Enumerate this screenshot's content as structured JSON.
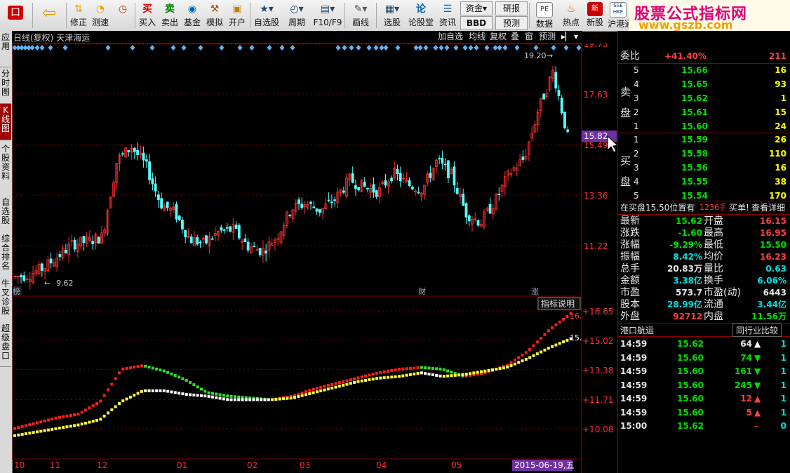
{
  "toolbar": {
    "items": [
      {
        "label": "",
        "icon": "app-logo-icon"
      },
      {
        "label": "",
        "icon": "back-arrow-icon"
      },
      {
        "label": "修正",
        "icon": "up-down-arrows-icon"
      },
      {
        "label": "测速",
        "icon": "speedometer-icon"
      },
      {
        "label": "买入",
        "icon": "buy-icon",
        "glyph": "买"
      },
      {
        "label": "卖出",
        "icon": "sell-icon",
        "glyph": "卖"
      },
      {
        "label": "基金",
        "icon": "fund-icon"
      },
      {
        "label": "模拟",
        "icon": "hammer-icon"
      },
      {
        "label": "开户",
        "icon": "lock-icon"
      },
      {
        "label": "自选股",
        "icon": "star-folder-icon"
      },
      {
        "label": "周期",
        "icon": "clock-icon"
      },
      {
        "label": "F10/F9",
        "icon": "f10-icon"
      },
      {
        "label": "画线",
        "icon": "pencil-icon"
      },
      {
        "label": "选股",
        "icon": "screen-icon"
      },
      {
        "label": "论股堂",
        "icon": "discuss-icon",
        "glyph": "论"
      },
      {
        "label": "资讯",
        "icon": "news-icon"
      },
      {
        "label": "数据",
        "icon": "pe-icon",
        "glyph": "PE"
      },
      {
        "label": "热点",
        "icon": "hot-icon"
      },
      {
        "label": "新股",
        "icon": "ipo-icon"
      },
      {
        "label": "沪港通",
        "icon": "sse-hkex-icon",
        "glyph": "SSE HKE"
      }
    ],
    "small_buttons": {
      "zijin": "资金",
      "bbd": "BBD",
      "yanbao": "研报",
      "yuce": "预测"
    },
    "brand_title": "股票公式指标网",
    "brand_url": "www.gszb.com"
  },
  "left_tabs": [
    "应用",
    "分时图",
    "K线图",
    "个股资料",
    "自选股",
    "综合排名",
    "牛叉诊股",
    "超级盘口"
  ],
  "chart": {
    "title": "日线(复权) 天津海运",
    "buttons": [
      "加自选",
      "均线",
      "复权",
      "叠",
      "窗",
      "预测"
    ],
    "price_axis": [
      "19.73",
      "17.63",
      "15.49",
      "13.36",
      "11.22"
    ],
    "current_price_tag": "15.82",
    "high_label": "19.20",
    "low_label": "9.62",
    "markers": [
      "榜",
      "财",
      "涨"
    ],
    "indicator_button": "指标说明",
    "indicator_axis": [
      "+16.65",
      "+15.02",
      "+13.38",
      "+11.71",
      "+10.08"
    ],
    "ind_end_red": "16.",
    "ind_end_yellow": "15.",
    "x_labels": [
      "10",
      "11",
      "12",
      "01",
      "02",
      "03",
      "04",
      "05"
    ],
    "date_tag": "2015-06-19,五"
  },
  "chart_data": {
    "type": "candlestick",
    "title": "日线(复权) 天津海运",
    "y_ticks": [
      19.73,
      17.63,
      15.49,
      13.36,
      11.22
    ],
    "high": 19.2,
    "low": 9.62,
    "last": 15.82,
    "months": [
      "10",
      "11",
      "12",
      "01",
      "02",
      "03",
      "04",
      "05"
    ],
    "trend": [
      9.9,
      10.0,
      10.3,
      10.8,
      11.3,
      11.4,
      11.6,
      14.8,
      15.4,
      14.6,
      13.0,
      12.6,
      11.5,
      11.3,
      11.8,
      11.9,
      11.2,
      11.0,
      11.6,
      12.8,
      13.0,
      12.7,
      13.2,
      14.0,
      13.7,
      13.5,
      14.3,
      13.8,
      13.6,
      14.8,
      14.2,
      12.6,
      12.2,
      13.1,
      14.3,
      14.9,
      17.0,
      18.6,
      15.8
    ],
    "indicator": {
      "red": [
        10.1,
        10.4,
        10.7,
        10.9,
        11.6,
        13.4,
        13.6,
        13.3,
        12.8,
        12.1,
        11.9,
        11.8,
        11.7,
        11.9,
        12.3,
        12.6,
        12.9,
        13.2,
        13.4,
        13.5,
        13.4,
        13.0,
        13.2,
        13.6,
        14.4,
        15.6,
        16.5
      ],
      "yellow": [
        9.7,
        9.9,
        10.1,
        10.3,
        10.6,
        11.6,
        12.2,
        12.2,
        12.0,
        11.9,
        11.7,
        11.7,
        11.7,
        11.8,
        12.1,
        12.4,
        12.7,
        12.9,
        13.0,
        13.2,
        13.0,
        13.1,
        13.3,
        13.5,
        14.0,
        14.6,
        15.1
      ],
      "y_ticks": [
        16.65,
        15.02,
        13.38,
        11.71,
        10.08
      ]
    }
  },
  "order_book": {
    "weibi_label": "委比",
    "weibi_value": "+41.40%",
    "weibi_count": "211",
    "sell_label": "卖盘",
    "buy_label": "买盘",
    "sell": [
      {
        "lvl": "5",
        "price": "15.66",
        "vol": "16"
      },
      {
        "lvl": "4",
        "price": "15.65",
        "vol": "93"
      },
      {
        "lvl": "3",
        "price": "15.62",
        "vol": "1"
      },
      {
        "lvl": "2",
        "price": "15.61",
        "vol": "15"
      },
      {
        "lvl": "1",
        "price": "15.60",
        "vol": "24"
      }
    ],
    "buy": [
      {
        "lvl": "1",
        "price": "15.59",
        "vol": "26"
      },
      {
        "lvl": "2",
        "price": "15.58",
        "vol": "110"
      },
      {
        "lvl": "3",
        "price": "15.56",
        "vol": "16"
      },
      {
        "lvl": "4",
        "price": "15.55",
        "vol": "38"
      },
      {
        "lvl": "5",
        "price": "15.54",
        "vol": "170"
      }
    ],
    "notice_pre": "在买盘15.50位置有",
    "notice_vol": "1236手",
    "notice_post": "买单!",
    "notice_link": "查看详细"
  },
  "quote": [
    [
      "最新",
      "15.62",
      "开盘",
      "16.15"
    ],
    [
      "涨跌",
      "-1.60",
      "最高",
      "16.95"
    ],
    [
      "涨幅",
      "-9.29%",
      "最低",
      "15.50"
    ],
    [
      "振幅",
      "8.42%",
      "均价",
      "16.23"
    ],
    [
      "总手",
      "20.83万",
      "量比",
      "0.63"
    ],
    [
      "金额",
      "3.38亿",
      "换手",
      "6.06%"
    ],
    [
      "市盈",
      "573.7",
      "市盈(动)",
      "6443"
    ],
    [
      "股本",
      "28.99亿",
      "流通",
      "3.44亿"
    ],
    [
      "外盘",
      "92712",
      "内盘",
      "11.56万"
    ]
  ],
  "sector": {
    "name": "港口航运",
    "compare": "同行业比较"
  },
  "ticks": [
    {
      "time": "14:59",
      "price": "15.62",
      "vol": "64",
      "dir": "up",
      "n": "1"
    },
    {
      "time": "14:59",
      "price": "15.60",
      "vol": "74",
      "dir": "down",
      "n": "1"
    },
    {
      "time": "14:59",
      "price": "15.60",
      "vol": "161",
      "dir": "down",
      "n": "1"
    },
    {
      "time": "14:59",
      "price": "15.60",
      "vol": "245",
      "dir": "down",
      "n": "1"
    },
    {
      "time": "14:59",
      "price": "15.60",
      "vol": "12",
      "dir": "up",
      "n": "1"
    },
    {
      "time": "14:59",
      "price": "15.60",
      "vol": "5",
      "dir": "up",
      "n": "1"
    },
    {
      "time": "15:00",
      "price": "15.62",
      "vol": "",
      "dir": "none",
      "n": "0"
    }
  ]
}
